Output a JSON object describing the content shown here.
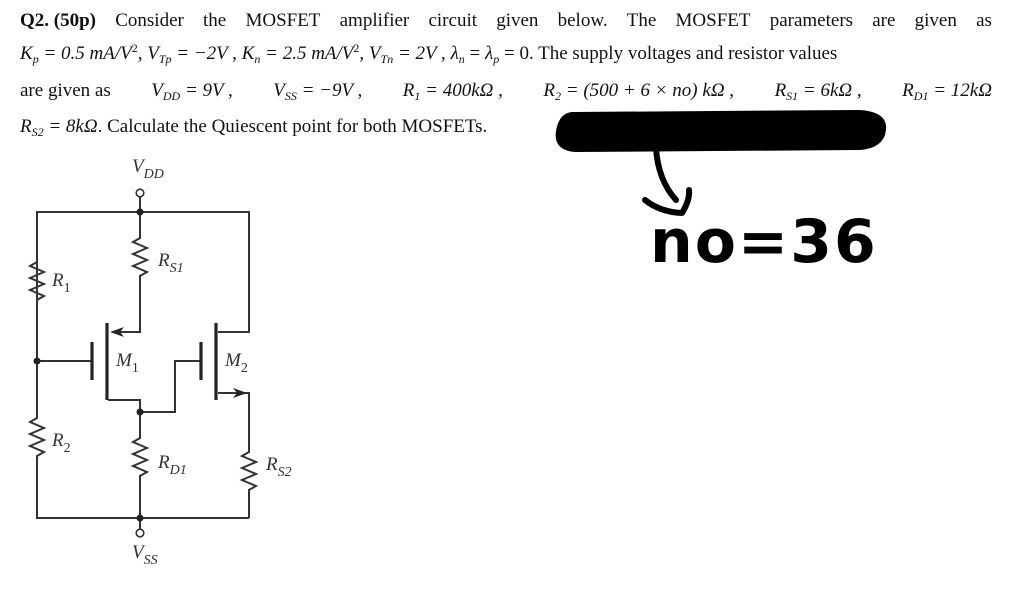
{
  "question": {
    "number": "Q2.",
    "points": "(50p)",
    "intro_words": [
      "Consider",
      "the",
      "MOSFET",
      "amplifier",
      "circuit",
      "given",
      "below.",
      "The",
      "MOSFET",
      "parameters",
      "are",
      "given",
      "as"
    ],
    "params_line": {
      "Kp": "K",
      "Kp_sub": "p",
      "Kp_val": " = 0.5 mA/V",
      "Kp_exp": "2",
      "VTp": ", V",
      "VTp_sub": "Tp",
      "VTp_val": " = −2V , ",
      "Kn": "K",
      "Kn_sub": "n",
      "Kn_val": " = 2.5 mA/V",
      "Kn_exp": "2",
      "VTn": ", V",
      "VTn_sub": "Tn",
      "VTn_val": " = 2V  ,  ",
      "lam_n": "λ",
      "lam_n_sub": "n",
      "lam_eq": " = ",
      "lam_p": "λ",
      "lam_p_sub": "p",
      "lam_val": " = 0",
      "tail": ". The supply voltages and resistor values"
    },
    "supply_line": {
      "lead": "are  given  as",
      "VDD": "V",
      "VDD_sub": "DD",
      "VDD_val": " = 9V ,",
      "VSS": "V",
      "VSS_sub": "SS",
      "VSS_val": " = −9V ,",
      "R1": "R",
      "R1_sub": "1",
      "R1_val": " = 400kΩ ,",
      "R2": "R",
      "R2_sub": "2",
      "R2_val": " = (500 + 6 × no) kΩ ,",
      "RS1": "R",
      "RS1_sub": "S1",
      "RS1_val": " = 6kΩ   ,",
      "RD1": "R",
      "RD1_sub": "D1",
      "RD1_val": " = 12kΩ"
    },
    "last_line": {
      "RS2": "R",
      "RS2_sub": "S2",
      "RS2_val": " = 8kΩ",
      "text": ". Calculate the Quiescent point for both MOSFETs."
    }
  },
  "circuit": {
    "labels": {
      "vdd": "V",
      "vdd_sub": "DD",
      "vss": "V",
      "vss_sub": "SS",
      "r1": "R",
      "r1_sub": "1",
      "r2": "R",
      "r2_sub": "2",
      "rs1": "R",
      "rs1_sub": "S1",
      "rd1": "R",
      "rd1_sub": "D1",
      "rs2": "R",
      "rs2_sub": "S2",
      "m1": "M",
      "m1_sub": "1",
      "m2": "M",
      "m2_sub": "2"
    }
  },
  "annotation": {
    "handwritten": "no=36",
    "redaction_color": "#000000"
  }
}
